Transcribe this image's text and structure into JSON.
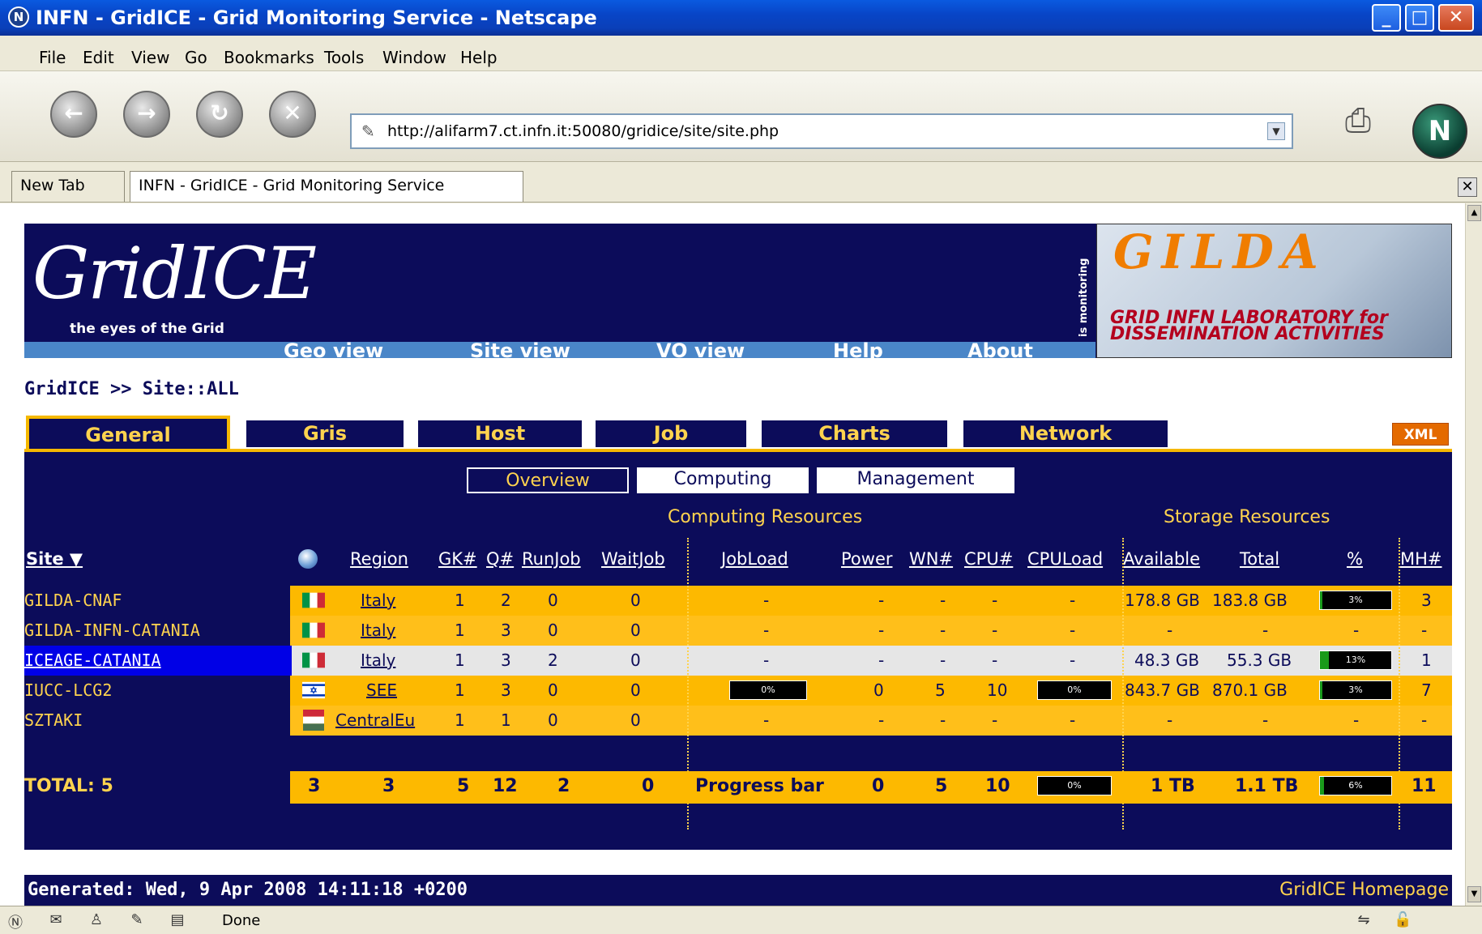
{
  "window": {
    "title": "INFN - GridICE - Grid Monitoring Service - Netscape",
    "buttons": [
      "_",
      "□",
      "X"
    ]
  },
  "menu": [
    "File",
    "Edit",
    "View",
    "Go",
    "Bookmarks",
    "Tools",
    "Window",
    "Help"
  ],
  "url": "http://alifarm7.ct.infn.it:50080/gridice/site/site.php",
  "browser_tabs": [
    "New Tab",
    "INFN - GridICE - Grid Monitoring Service"
  ],
  "header": {
    "logo": "GridICE",
    "logo_sub": "the eyes of the Grid",
    "side_text": "is monitoring",
    "nav": [
      "Geo view",
      "Site view",
      "VO view",
      "Help",
      "About"
    ],
    "banner_title": "GILDA",
    "banner_sub": "GRID INFN LABORATORY for DISSEMINATION ACTIVITIES"
  },
  "breadcrumb": "GridICE >> Site::ALL",
  "main_tabs": [
    "General",
    "Gris",
    "Host",
    "Job",
    "Charts",
    "Network"
  ],
  "xml_label": "XML",
  "sub_tabs": [
    "Overview",
    "Computing",
    "Management"
  ],
  "sections": {
    "computing": "Computing Resources",
    "storage": "Storage Resources"
  },
  "columns": {
    "site": "Site ▼",
    "region": "Region",
    "gk": "GK#",
    "q": "Q#",
    "runjob": "RunJob",
    "waitjob": "WaitJob",
    "jobload": "JobLoad",
    "power": "Power",
    "wn": "WN#",
    "cpu": "CPU#",
    "cpuload": "CPULoad",
    "available": "Available",
    "total": "Total",
    "pct": "%",
    "mh": "MH#"
  },
  "rows": [
    {
      "site": "GILDA-CNAF",
      "flag": "it",
      "region": "Italy",
      "gk": "1",
      "q": "2",
      "runjob": "0",
      "waitjob": "0",
      "jobload": "-",
      "power": "-",
      "wn": "-",
      "cpu": "-",
      "cpuload": "-",
      "available": "178.8 GB",
      "total": "183.8 GB",
      "pct": "3%",
      "pct_value": 3,
      "mh": "3"
    },
    {
      "site": "GILDA-INFN-CATANIA",
      "flag": "it",
      "region": "Italy",
      "gk": "1",
      "q": "3",
      "runjob": "0",
      "waitjob": "0",
      "jobload": "-",
      "power": "-",
      "wn": "-",
      "cpu": "-",
      "cpuload": "-",
      "available": "-",
      "total": "-",
      "pct": "-",
      "mh": "-"
    },
    {
      "site": "ICEAGE-CATANIA",
      "flag": "it",
      "region": "Italy",
      "gk": "1",
      "q": "3",
      "runjob": "2",
      "waitjob": "0",
      "jobload": "-",
      "power": "-",
      "wn": "-",
      "cpu": "-",
      "cpuload": "-",
      "available": "48.3 GB",
      "total": "55.3 GB",
      "pct": "13%",
      "pct_value": 13,
      "mh": "1"
    },
    {
      "site": "IUCC-LCG2",
      "flag": "il",
      "region": "SEE",
      "gk": "1",
      "q": "3",
      "runjob": "0",
      "waitjob": "0",
      "jobload": "0%",
      "jobload_value": 0,
      "power": "0",
      "wn": "5",
      "cpu": "10",
      "cpuload": "0%",
      "cpuload_value": 0,
      "available": "843.7 GB",
      "total": "870.1 GB",
      "pct": "3%",
      "pct_value": 3,
      "mh": "7"
    },
    {
      "site": "SZTAKI",
      "flag": "hu",
      "region": "CentralEu",
      "gk": "1",
      "q": "1",
      "runjob": "0",
      "waitjob": "0",
      "jobload": "-",
      "power": "-",
      "wn": "-",
      "cpu": "-",
      "cpuload": "-",
      "available": "-",
      "total": "-",
      "pct": "-",
      "mh": "-"
    }
  ],
  "total": {
    "label": "TOTAL: 5",
    "flags": "3",
    "region": "3",
    "gk": "5",
    "q": "12",
    "runjob": "2",
    "waitjob": "0",
    "jobload": "Progress bar",
    "power": "0",
    "wn": "5",
    "cpu": "10",
    "cpuload": "0%",
    "cpuload_value": 0,
    "available": "1 TB",
    "total": "1.1 TB",
    "pct": "6%",
    "pct_value": 6,
    "mh": "11"
  },
  "footer": {
    "generated": "Generated: Wed, 9 Apr 2008 14:11:18 +0200",
    "homepage": "GridICE Homepage"
  },
  "status": "Done",
  "colors": {
    "page_bg": "#0c0c5a",
    "row_yellow": "#fdb900",
    "row_yellow2": "#ffbf1a",
    "row_grey": "#e6e6e6",
    "text_yellow": "#ffd34e"
  }
}
